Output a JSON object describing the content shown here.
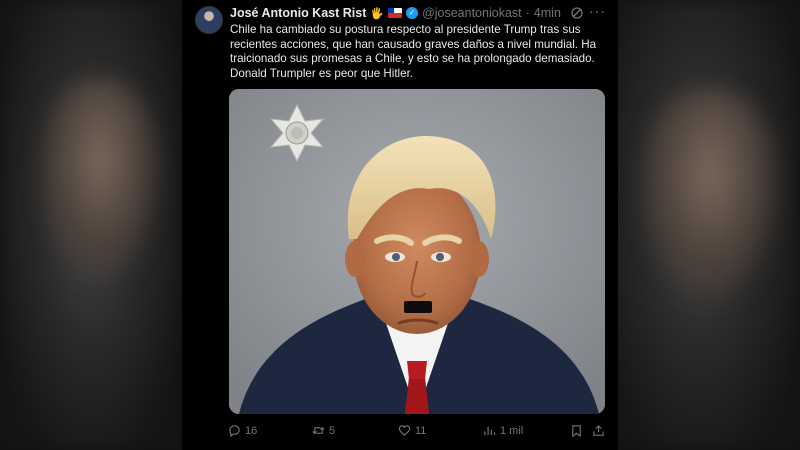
{
  "tweet": {
    "author_name": "José Antonio Kast Rist",
    "emoji": "🖐️",
    "handle": "@joseantoniokast",
    "separator": "·",
    "time": "4min",
    "text": "Chile ha cambiado su postura respecto al presidente Trump tras sus recientes acciones, que han causado graves daños a nivel mundial. Ha traicionado sus promesas a Chile, y esto se ha prolongado demasiado. Donald Trumpler es peor que Hitler.",
    "more_label": "···"
  },
  "actions": {
    "replies": "16",
    "reposts": "5",
    "likes": "11",
    "views": "1 mil"
  },
  "icons": {
    "reply": "reply-icon",
    "repost": "repost-icon",
    "like": "heart-icon",
    "views": "views-icon",
    "bookmark": "bookmark-icon",
    "share": "share-icon",
    "grok": "grok-icon",
    "more": "more-icon",
    "verified": "verified-badge-icon",
    "flag": "chile-flag-icon"
  },
  "colors": {
    "background": "#000000",
    "text": "#e7e9ea",
    "muted": "#71767b",
    "verified": "#1d9bf0"
  }
}
